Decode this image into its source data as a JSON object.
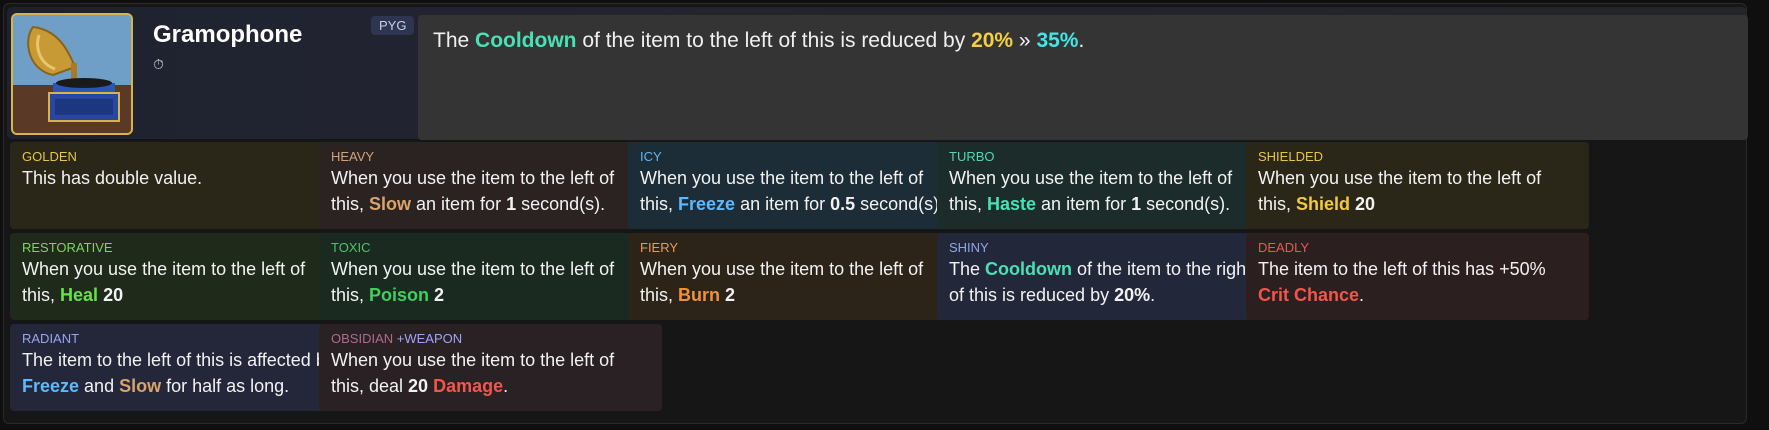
{
  "item": {
    "title": "Gramophone",
    "tag": "PYG",
    "timer_icon": "stopwatch-icon",
    "description": {
      "prefix": "The ",
      "keyword": "Cooldown",
      "middle": " of the item to the left of this is reduced by ",
      "from_value": "20%",
      "arrow": " » ",
      "to_value": "35%",
      "suffix": "."
    }
  },
  "enchantments": [
    {
      "name": "GOLDEN",
      "text_a": "This has double value.",
      "kw": "",
      "text_b": "",
      "val": "",
      "text_c": ""
    },
    {
      "name": "HEAVY",
      "text_a": "When you use the item to the left of this, ",
      "kw": "Slow",
      "text_b": " an item for ",
      "val": "1",
      "text_c": " second(s)."
    },
    {
      "name": "ICY",
      "text_a": "When you use the item to the left of this, ",
      "kw": "Freeze",
      "text_b": " an item for ",
      "val": "0.5",
      "text_c": " second(s)."
    },
    {
      "name": "TURBO",
      "text_a": "When you use the item to the left of this, ",
      "kw": "Haste",
      "text_b": " an item for ",
      "val": "1",
      "text_c": " second(s)."
    },
    {
      "name": "SHIELDED",
      "text_a": "When you use the item to the left of this, ",
      "kw": "Shield",
      "text_b": " ",
      "val": "20",
      "text_c": ""
    },
    {
      "name": "RESTORATIVE",
      "text_a": "When you use the item to the left of this, ",
      "kw": "Heal",
      "text_b": " ",
      "val": "20",
      "text_c": ""
    },
    {
      "name": "TOXIC",
      "text_a": "When you use the item to the left of this, ",
      "kw": "Poison",
      "text_b": " ",
      "val": "2",
      "text_c": ""
    },
    {
      "name": "FIERY",
      "text_a": "When you use the item to the left of this, ",
      "kw": "Burn",
      "text_b": " ",
      "val": "2",
      "text_c": ""
    },
    {
      "name": "SHINY",
      "text_a": "The ",
      "kw": "Cooldown",
      "text_b": " of the item to the right of this is reduced by ",
      "val": "20%",
      "text_c": "."
    },
    {
      "name": "DEADLY",
      "text_a": "The item to the left of this has +50% ",
      "kw": "Crit Chance",
      "text_b": ".",
      "val": "",
      "text_c": ""
    },
    {
      "name": "RADIANT",
      "text_a": "The item to the left of this is affected by ",
      "kw": "Freeze",
      "text_b": " and ",
      "kw2": "Slow",
      "text_c": " for half as long."
    },
    {
      "name": "OBSIDIAN",
      "extra_tag": "+WEAPON",
      "text_a": "When you use the item to the left of this, deal ",
      "val": "20",
      "text_b": " ",
      "kw": "Damage",
      "text_c": "."
    }
  ]
}
